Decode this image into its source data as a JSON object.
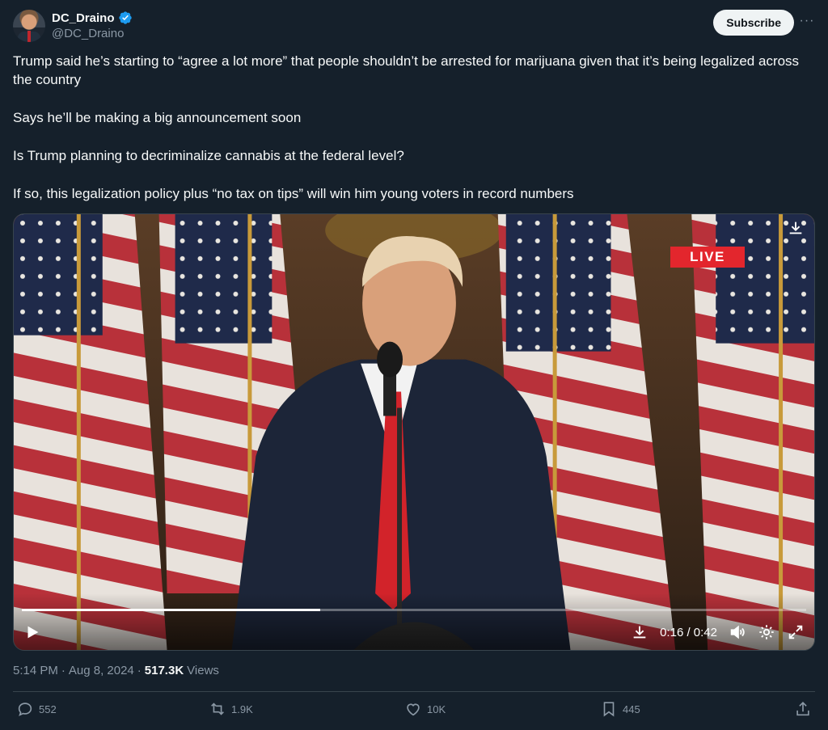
{
  "author": {
    "display_name": "DC_Draino",
    "handle": "@DC_Draino",
    "verified": true,
    "avatar_icon": "profile-photo"
  },
  "header": {
    "subscribe_label": "Subscribe",
    "more_icon": "ellipsis-icon"
  },
  "tweet": {
    "paragraphs": [
      "Trump said he’s starting to “agree a lot more” that people shouldn’t be arrested for marijuana given that it’s being legalized across the country",
      "Says he’ll be making a big announcement soon",
      "Is Trump planning to decriminalize cannabis at the federal level?",
      "If so, this legalization policy plus “no tax on tips” will win him young voters in record numbers"
    ]
  },
  "video": {
    "live_badge": "LIVE",
    "current_time": "0:16",
    "duration": "0:42",
    "time_display": "0:16 / 0:42",
    "progress_fraction": 0.38
  },
  "meta": {
    "time": "5:14 PM",
    "separator": "·",
    "date": "Aug 8, 2024",
    "views_count": "517.3K",
    "views_label": "Views"
  },
  "actions": {
    "replies": "552",
    "reposts": "1.9K",
    "likes": "10K",
    "bookmarks": "445"
  },
  "colors": {
    "background": "#15202b",
    "text_primary": "#f7f9f9",
    "text_secondary": "#8b98a5",
    "verified_blue": "#1d9bf0",
    "live_red": "#e3262d",
    "border": "#38444d"
  }
}
